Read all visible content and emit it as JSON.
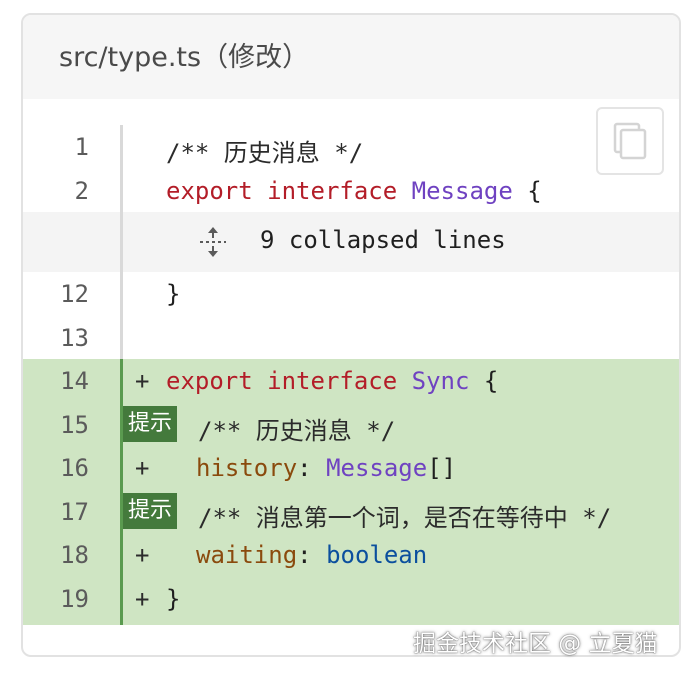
{
  "file_header": {
    "title": "src/type.ts（修改）"
  },
  "copy_button": {
    "icon": "copy-icon"
  },
  "lines": [
    {
      "num": "1",
      "text": "/** 历史消息 */"
    },
    {
      "num": "2",
      "kw": "export interface ",
      "type": "Message",
      "rest": " {"
    },
    {
      "num": "12",
      "text": "}"
    },
    {
      "num": "13",
      "text": ""
    },
    {
      "num": "14",
      "marker": "+",
      "kw": "export interface ",
      "type": "Sync",
      "rest": " {"
    },
    {
      "num": "15",
      "badge": "提示",
      "text": "/** 历史消息 */"
    },
    {
      "num": "16",
      "marker": "+",
      "prop": "history",
      "colon": ": ",
      "type": "Message",
      "rest": "[]"
    },
    {
      "num": "17",
      "badge": "提示",
      "text": "/** 消息第一个词，是否在等待中 */"
    },
    {
      "num": "18",
      "marker": "+",
      "prop": "waiting",
      "colon": ": ",
      "prim": "boolean"
    },
    {
      "num": "19",
      "marker": "+",
      "text": "}"
    }
  ],
  "collapsed": {
    "label": "9 collapsed lines",
    "icon": "expand-icon"
  },
  "watermark": "掘金技术社区 @ 立夏猫",
  "colors": {
    "added_bg": "#cfe5c3",
    "added_gutter": "#5a9a4f",
    "badge": "#447a3c",
    "keyword": "#b31d28",
    "type": "#6f42c1"
  }
}
